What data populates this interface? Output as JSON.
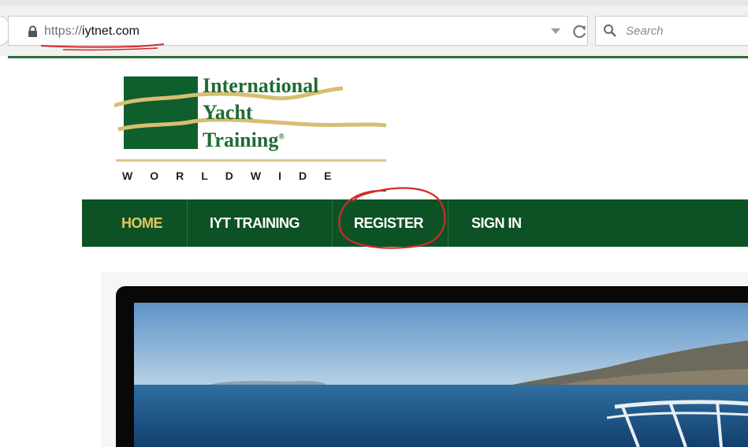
{
  "browser": {
    "url_scheme": "https://",
    "url_host": "iytnet.com",
    "search_placeholder": "Search",
    "icons": [
      "lock-icon",
      "dropdown-arrow-icon",
      "reload-icon",
      "search-icon"
    ]
  },
  "site": {
    "logo": {
      "line1": "International",
      "line2": "Yacht",
      "line3": "Training",
      "registered": "®",
      "tagline": "WORLDWIDE"
    },
    "nav": {
      "items": [
        {
          "label": "HOME",
          "active": true
        },
        {
          "label": "IYT TRAINING",
          "active": false
        },
        {
          "label": "REGISTER",
          "active": false
        },
        {
          "label": "SIGN IN",
          "active": false
        }
      ]
    }
  },
  "colors": {
    "nav_bg": "#0d5225",
    "nav_active": "#e3c761",
    "logo_green": "#0f5f2d",
    "annotation_red": "#d42a2a"
  }
}
